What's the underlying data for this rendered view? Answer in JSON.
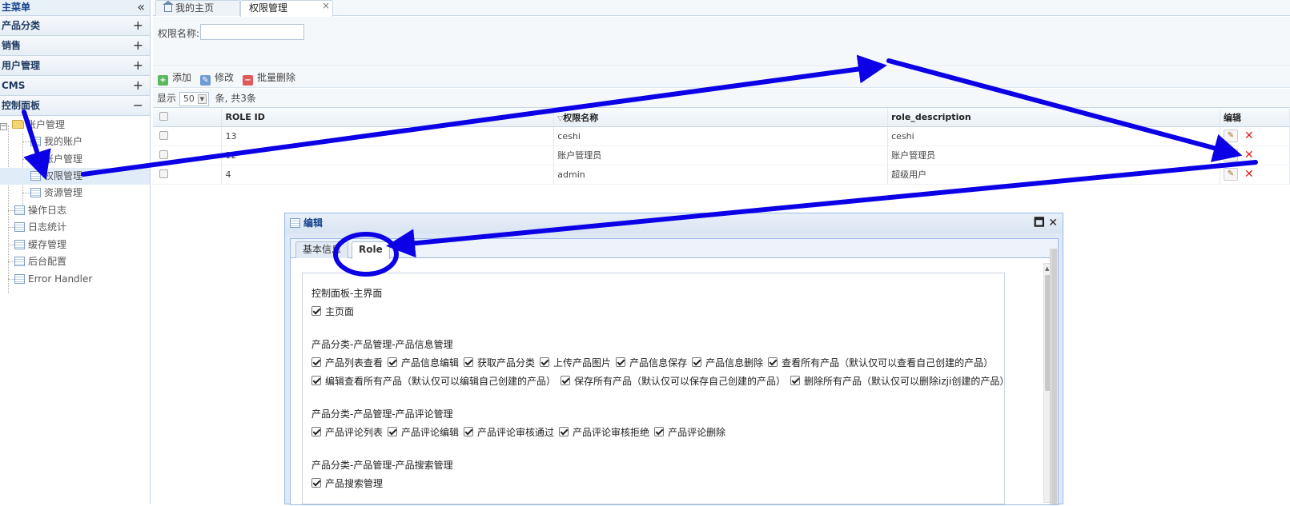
{
  "sidebar": {
    "title": "主菜单",
    "collapse_icon": "«",
    "sections": [
      {
        "label": "产品分类",
        "toggle": "+"
      },
      {
        "label": "销售",
        "toggle": "+"
      },
      {
        "label": "用户管理",
        "toggle": "+"
      },
      {
        "label": "CMS",
        "toggle": "+"
      },
      {
        "label": "控制面板",
        "toggle": "−"
      }
    ],
    "tree": {
      "root": "账户管理",
      "children": [
        "我的账户",
        "账户管理",
        "权限管理",
        "资源管理"
      ],
      "items": [
        "操作日志",
        "日志统计",
        "缓存管理",
        "后台配置",
        "Error Handler"
      ]
    }
  },
  "tabs": [
    {
      "label": "我的主页",
      "icon": "home-icon"
    },
    {
      "label": "权限管理",
      "close": "×"
    }
  ],
  "search": {
    "label": "权限名称:",
    "value": ""
  },
  "toolbar": {
    "add": "添加",
    "edit": "修改",
    "batch_delete": "批量删除"
  },
  "pager": {
    "prefix": "显示",
    "page_size": "50",
    "suffix": "条, 共3条"
  },
  "grid": {
    "columns": [
      "ROLE ID",
      "权限名称",
      "role_description",
      "编辑"
    ],
    "rows": [
      {
        "id": "13",
        "name": "ceshi",
        "desc": "ceshi"
      },
      {
        "id": "12",
        "name": "账户管理员",
        "desc": "账户管理员"
      },
      {
        "id": "4",
        "name": "admin",
        "desc": "超级用户"
      }
    ]
  },
  "dialog": {
    "title": "编辑",
    "tabs": [
      "基本信息",
      "Role"
    ],
    "groups": [
      {
        "title": "控制面板-主界面",
        "rows": [
          [
            "主页面"
          ]
        ]
      },
      {
        "title": "产品分类-产品管理-产品信息管理",
        "rows": [
          [
            "产品列表查看",
            "产品信息编辑",
            "获取产品分类",
            "上传产品图片",
            "产品信息保存",
            "产品信息删除",
            "查看所有产品（默认仅可以查看自己创建的产品）"
          ],
          [
            "编辑查看所有产品（默认仅可以编辑自己创建的产品）",
            "保存所有产品（默认仅可以保存自己创建的产品）",
            "删除所有产品（默认仅可以删除izji创建的产品）"
          ]
        ]
      },
      {
        "title": "产品分类-产品管理-产品评论管理",
        "rows": [
          [
            "产品评论列表",
            "产品评论编辑",
            "产品评论审核通过",
            "产品评论审核拒绝",
            "产品评论删除"
          ]
        ]
      },
      {
        "title": "产品分类-产品管理-产品搜索管理",
        "rows": [
          [
            "产品搜索管理"
          ]
        ]
      }
    ]
  },
  "annotation_color": "#0b00e6"
}
